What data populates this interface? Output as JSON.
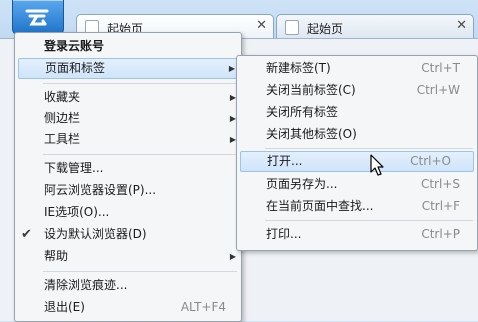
{
  "tabs": [
    {
      "title": "起始页",
      "active": true
    },
    {
      "title": "起始页",
      "active": false
    }
  ],
  "tab_close_glyph": "✕",
  "main_menu": {
    "items": [
      {
        "label": "登录云账号",
        "bold": true
      },
      {
        "label": "页面和标签",
        "submenu": true,
        "highlighted": true
      },
      {
        "label": "收藏夹",
        "submenu": true
      },
      {
        "label": "侧边栏",
        "submenu": true
      },
      {
        "label": "工具栏",
        "submenu": true
      },
      {
        "label": "下载管理..."
      },
      {
        "label": "阿云浏览器设置(P)..."
      },
      {
        "label": "IE选项(O)..."
      },
      {
        "label": "设为默认浏览器(D)",
        "checked": true
      },
      {
        "label": "帮助",
        "submenu": true
      },
      {
        "label": "清除浏览痕迹..."
      },
      {
        "label": "退出(E)",
        "shortcut": "ALT+F4"
      }
    ]
  },
  "sub_menu": {
    "items": [
      {
        "label": "新建标签(T)",
        "shortcut": "Ctrl+T"
      },
      {
        "label": "关闭当前标签(C)",
        "shortcut": "Ctrl+W"
      },
      {
        "label": "关闭所有标签",
        "shortcut": ""
      },
      {
        "label": "关闭其他标签(O)",
        "shortcut": ""
      },
      {
        "label": "打开...",
        "shortcut": "Ctrl+O",
        "highlighted": true
      },
      {
        "label": "页面另存为...",
        "shortcut": "Ctrl+S"
      },
      {
        "label": "在当前页面中查找...",
        "shortcut": "Ctrl+F"
      },
      {
        "label": "打印...",
        "shortcut": "Ctrl+P"
      }
    ]
  },
  "glyphs": {
    "arrow": "▶",
    "check": "✔"
  },
  "colors": {
    "highlight": "#cfe4fa",
    "logo": "#1f74c9"
  }
}
